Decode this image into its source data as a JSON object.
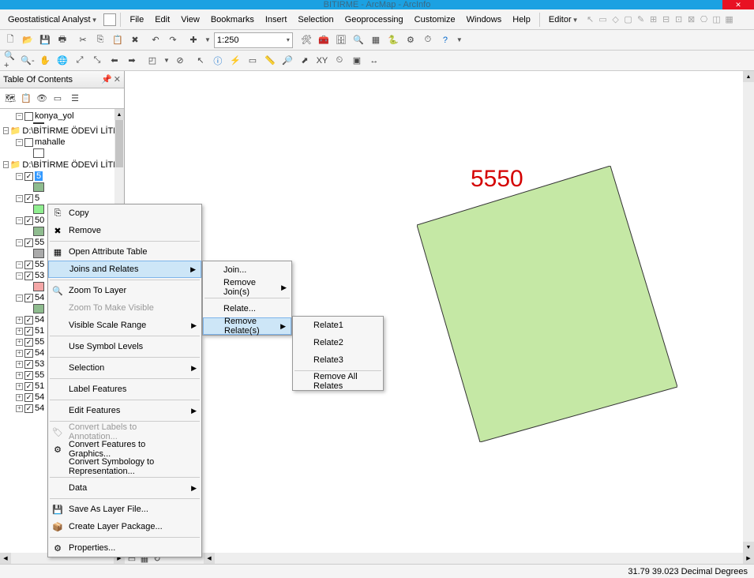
{
  "title": "BITIRME - ArcMap - ArcInfo",
  "menubar": {
    "geostat": "Geostatistical Analyst",
    "file": "File",
    "edit": "Edit",
    "view": "View",
    "bookmarks": "Bookmarks",
    "insert": "Insert",
    "selection": "Selection",
    "geoprocessing": "Geoprocessing",
    "customize": "Customize",
    "windows": "Windows",
    "help": "Help",
    "editor": "Editor"
  },
  "toolbar": {
    "scale": "1:250"
  },
  "toc": {
    "title": "Table Of Contents",
    "nodes": {
      "konya_yol": "konya_yol",
      "path1": "D:\\BİTİRME ÖDEVİ LİTERATÜ",
      "mahalle": "mahalle",
      "path2": "D:\\BİTİRME ÖDEVİ LİTERATÜ",
      "fivex": "5",
      "five0": "50",
      "fivefive": "55",
      "five3": "53",
      "five4": "54",
      "five41": "54",
      "five1": "51",
      "five50": "55",
      "five42": "54",
      "five31": "53",
      "five51": "55",
      "five11": "51",
      "five43": "54",
      "five44": "54"
    }
  },
  "map": {
    "label_value": "5550"
  },
  "context_menu_1": {
    "copy": "Copy",
    "remove": "Remove",
    "open_attr": "Open Attribute Table",
    "joins": "Joins and Relates",
    "zoom_layer": "Zoom To Layer",
    "zoom_visible": "Zoom To Make Visible",
    "vis_range": "Visible Scale Range",
    "use_sym": "Use Symbol Levels",
    "selection": "Selection",
    "label_feat": "Label Features",
    "edit_feat": "Edit Features",
    "conv_labels": "Convert Labels to Annotation...",
    "conv_feat": "Convert Features to Graphics...",
    "conv_sym": "Convert Symbology to Representation...",
    "data": "Data",
    "save_lyr": "Save As Layer File...",
    "create_pkg": "Create Layer Package...",
    "props": "Properties..."
  },
  "context_menu_2": {
    "join": "Join...",
    "remove_joins": "Remove Join(s)",
    "relate": "Relate...",
    "remove_relates": "Remove Relate(s)"
  },
  "context_menu_3": {
    "r1": "Relate1",
    "r2": "Relate2",
    "r3": "Relate3",
    "remove_all": "Remove All Relates"
  },
  "statusbar": {
    "coords": "31.79 39.023 Decimal Degrees"
  }
}
